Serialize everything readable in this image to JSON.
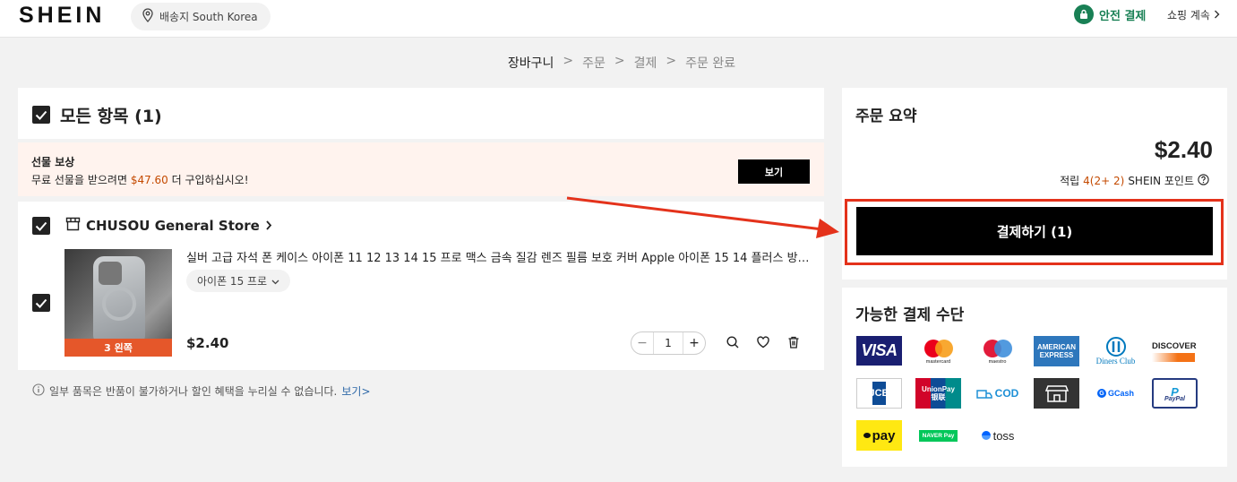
{
  "header": {
    "logo": "SHEIN",
    "ship_to": "배송지 South Korea",
    "secure_checkout": "안전 결제",
    "continue_shopping": "쇼핑 계속"
  },
  "breadcrumb": [
    "장바구니",
    "주문",
    "결제",
    "주문 완료"
  ],
  "cart": {
    "select_all_label": "모든 항목 (1)",
    "gift": {
      "title": "선물 보상",
      "desc_prefix": "무료 선물을 받으려면 ",
      "amount": "$47.60",
      "desc_suffix": " 더 구입하십시오!",
      "view_button": "보기"
    },
    "store": {
      "name": "CHUSOU General Store",
      "item": {
        "title": "실버 고급 자석 폰 케이스 아이폰 11 12 13 14 15 프로 맥스 금속 질감 렌즈 필름 보호 커버 Apple 아이폰 15 14 플러스 방…",
        "variant": "아이폰 15 프로",
        "stock_badge": "3 왼쪽",
        "price": "$2.40",
        "quantity": "1"
      }
    },
    "note_text": "일부 품목은 반품이 불가하거나 할인 혜택을 누리실 수 없습니다.",
    "note_link": "보기>"
  },
  "summary": {
    "title": "주문 요약",
    "total": "$2.40",
    "points_prefix": "적립 ",
    "points_value": "4(2+ 2)",
    "points_suffix": " SHEIN 포인트",
    "checkout_button": "결제하기 (1)"
  },
  "payment": {
    "title": "가능한 결제 수단",
    "methods": [
      {
        "name": "VISA",
        "label": "VISA"
      },
      {
        "name": "mastercard",
        "label": "mastercard"
      },
      {
        "name": "maestro",
        "label": "maestro"
      },
      {
        "name": "american-express",
        "label": "AMERICAN EXPRESS"
      },
      {
        "name": "diners-club",
        "label": "Diners Club"
      },
      {
        "name": "discover",
        "label": "DISCOVER"
      },
      {
        "name": "jcb",
        "label": "JCB"
      },
      {
        "name": "unionpay",
        "label": "UnionPay 银联"
      },
      {
        "name": "cod",
        "label": "COD"
      },
      {
        "name": "store",
        "label": ""
      },
      {
        "name": "gcash",
        "label": "GCash"
      },
      {
        "name": "paypal",
        "label": "PayPal"
      },
      {
        "name": "kakaopay",
        "label": "pay"
      },
      {
        "name": "naverpay",
        "label": "NAVER Pay"
      },
      {
        "name": "toss",
        "label": "toss"
      }
    ]
  },
  "colors": {
    "accent_green": "#198055",
    "price_orange": "#c44a01",
    "annotation_red": "#e4321b"
  }
}
